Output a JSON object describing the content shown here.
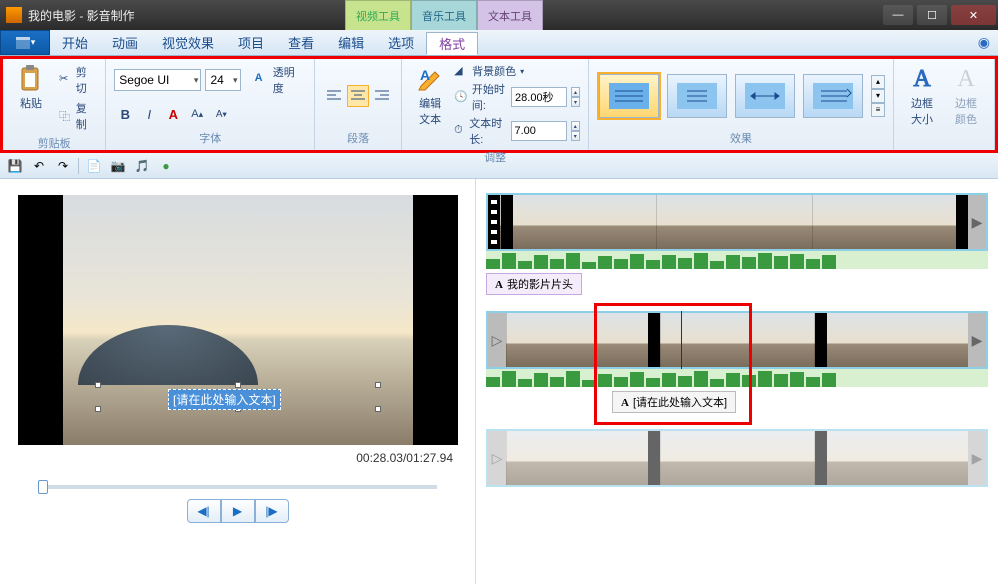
{
  "titlebar": {
    "title": "我的电影 - 影音制作",
    "tool_tabs": {
      "video": "视频工具",
      "audio": "音乐工具",
      "text": "文本工具"
    }
  },
  "menu": {
    "items": [
      "开始",
      "动画",
      "视觉效果",
      "项目",
      "查看",
      "编辑",
      "选项",
      "格式"
    ],
    "active_index": 7
  },
  "ribbon": {
    "clipboard": {
      "label": "剪贴板",
      "paste": "粘贴",
      "cut": "剪切",
      "copy": "复制"
    },
    "font": {
      "label": "字体",
      "name": "Segoe UI",
      "size": "24",
      "transparency": "透明度"
    },
    "paragraph": {
      "label": "段落"
    },
    "edit_text": {
      "label": "编辑\n文本"
    },
    "adjust": {
      "label": "调整",
      "bg_color": "背景颜色",
      "start_time_label": "开始时间:",
      "start_time_value": "28.00秒",
      "duration_label": "文本时长:",
      "duration_value": "7.00"
    },
    "effects": {
      "label": "效果"
    },
    "outline": {
      "size_label": "边框\n大小",
      "color_label": "边框\n颜色"
    }
  },
  "preview": {
    "text_placeholder": "[请在此处输入文本]",
    "time": "00:28.03/01:27.94"
  },
  "storyboard": {
    "caption1": "我的影片片头",
    "caption2": "[请在此处输入文本]"
  }
}
